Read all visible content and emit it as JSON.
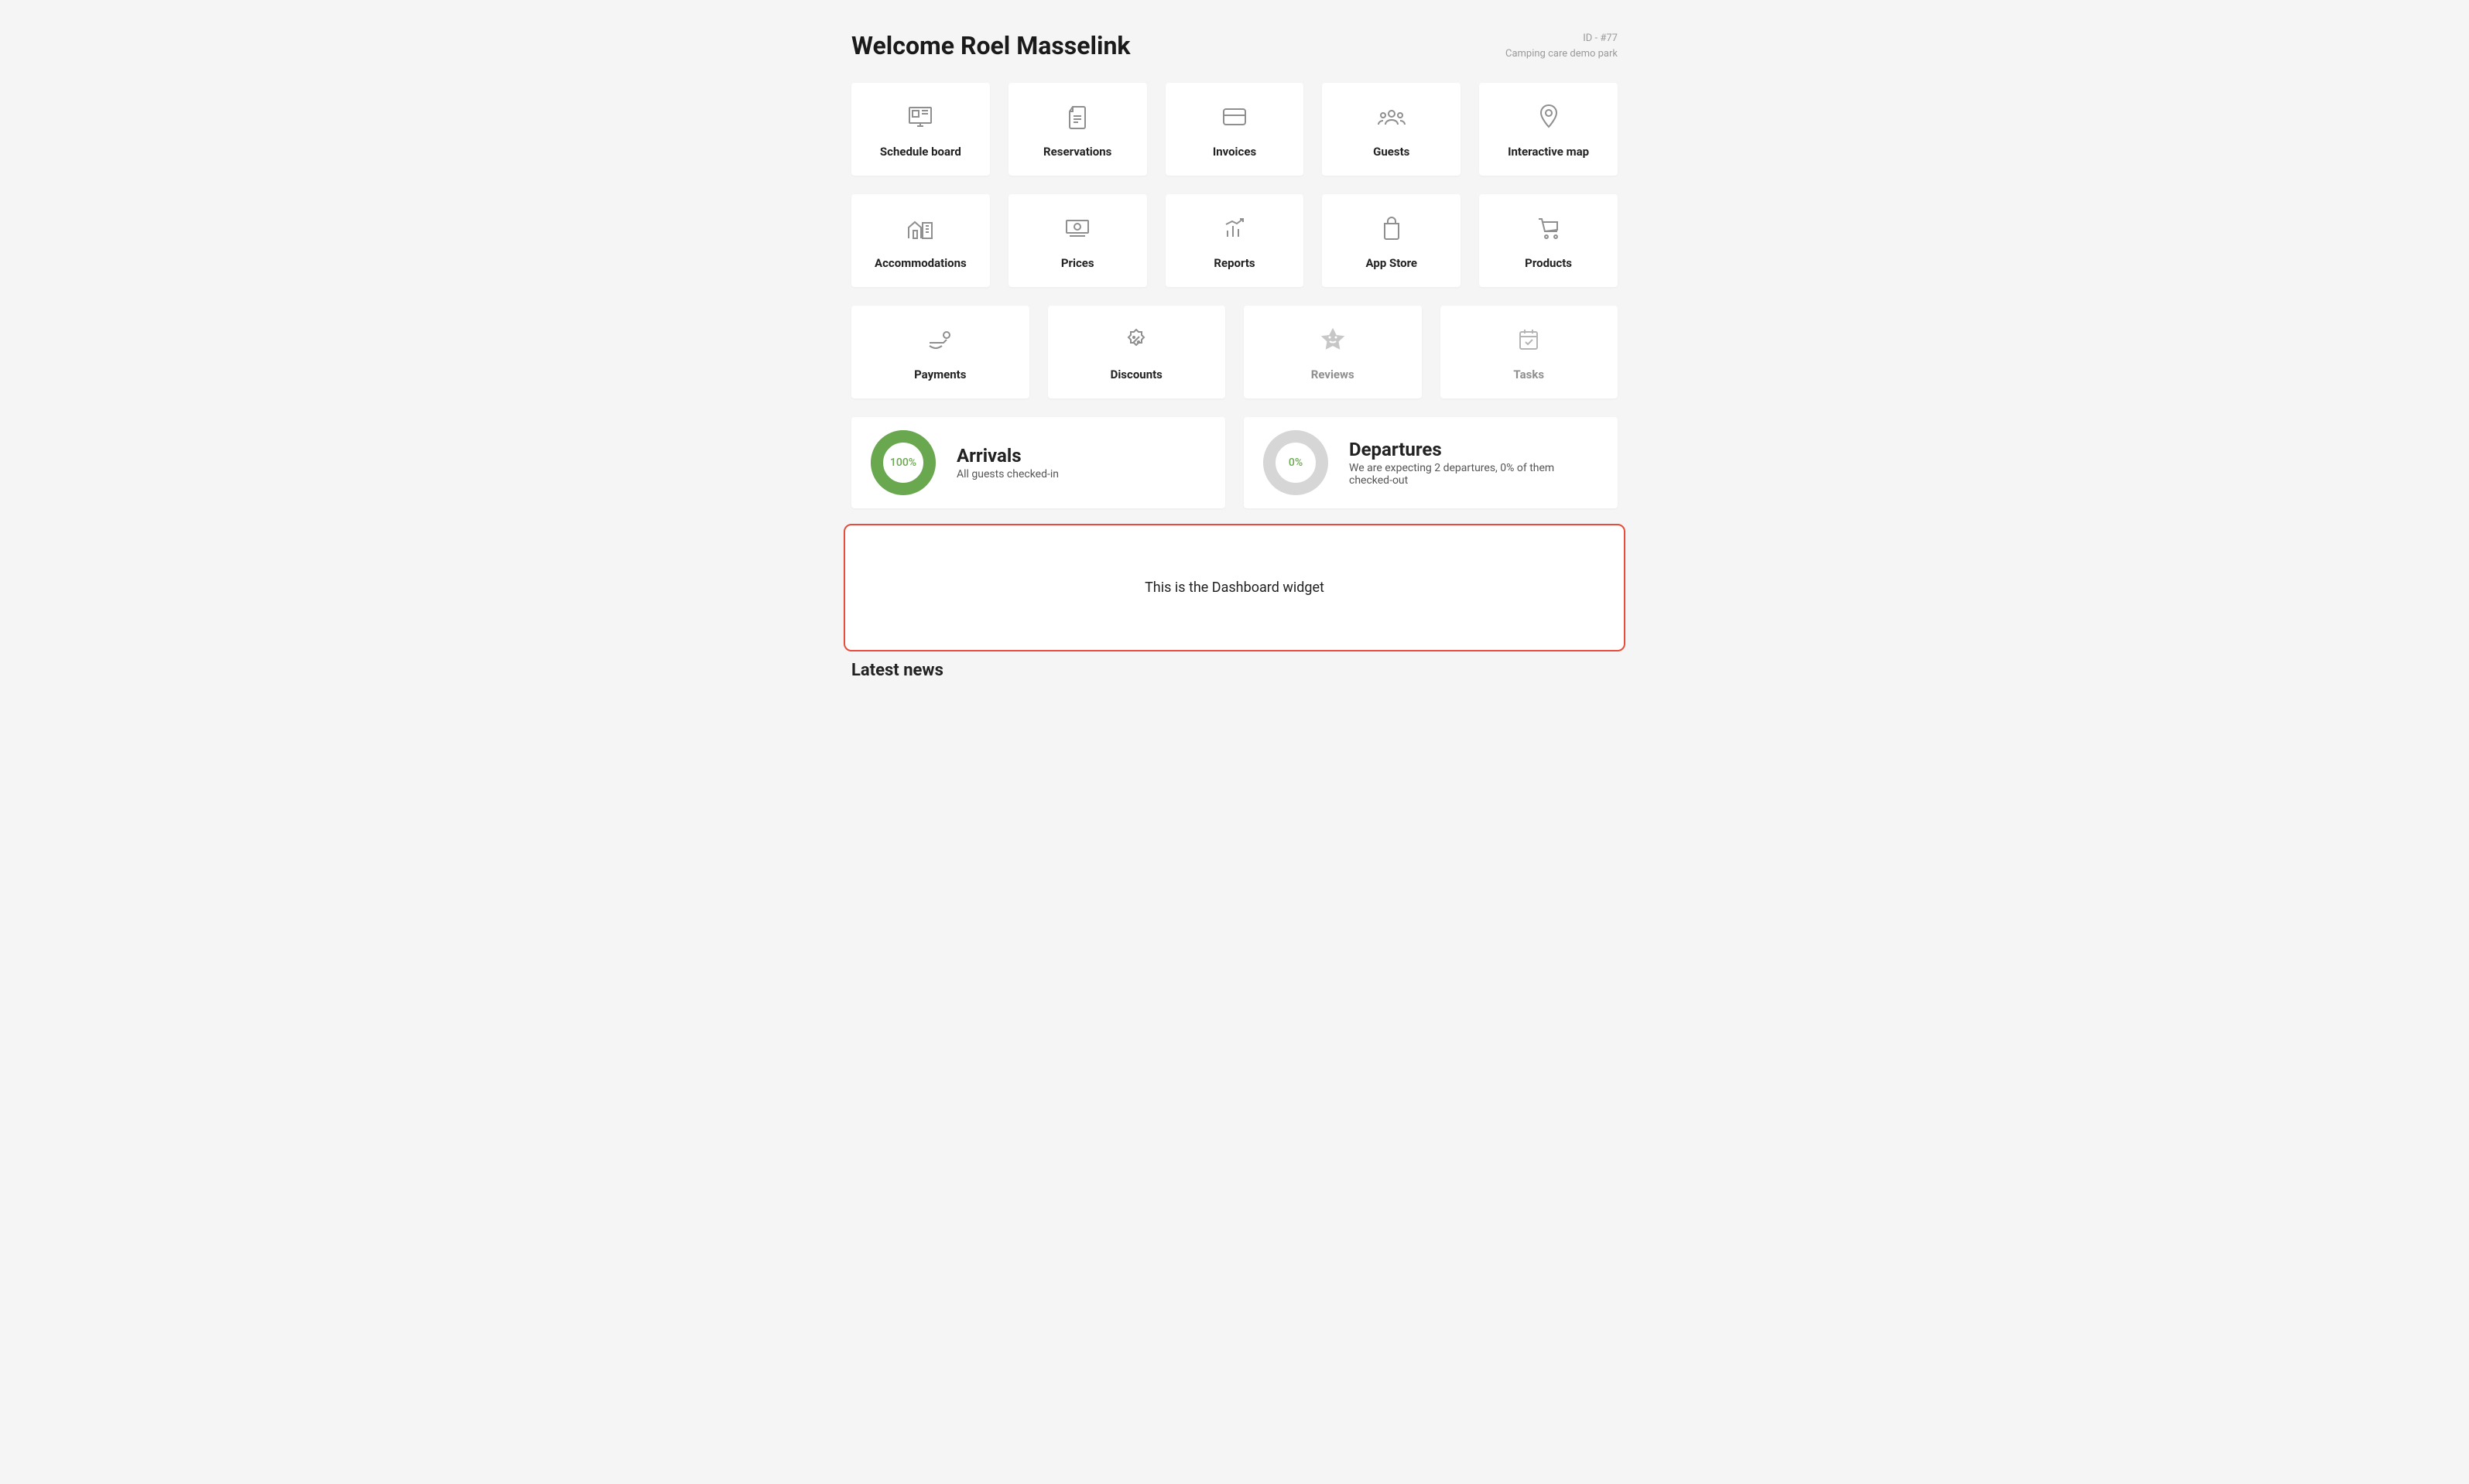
{
  "header": {
    "welcome": "Welcome Roel Masselink",
    "id_label": "ID - #77",
    "park_name": "Camping care demo park"
  },
  "tiles_row1": [
    {
      "label": "Schedule board",
      "icon": "schedule-board-icon",
      "muted": false
    },
    {
      "label": "Reservations",
      "icon": "reservations-icon",
      "muted": false
    },
    {
      "label": "Invoices",
      "icon": "invoices-icon",
      "muted": false
    },
    {
      "label": "Guests",
      "icon": "guests-icon",
      "muted": false
    },
    {
      "label": "Interactive map",
      "icon": "map-pin-icon",
      "muted": false
    }
  ],
  "tiles_row2": [
    {
      "label": "Accommodations",
      "icon": "accommodations-icon",
      "muted": false
    },
    {
      "label": "Prices",
      "icon": "prices-icon",
      "muted": false
    },
    {
      "label": "Reports",
      "icon": "reports-icon",
      "muted": false
    },
    {
      "label": "App Store",
      "icon": "app-store-icon",
      "muted": false
    },
    {
      "label": "Products",
      "icon": "products-icon",
      "muted": false
    }
  ],
  "tiles_row3": [
    {
      "label": "Payments",
      "icon": "payments-icon",
      "muted": false
    },
    {
      "label": "Discounts",
      "icon": "discounts-icon",
      "muted": false
    },
    {
      "label": "Reviews",
      "icon": "reviews-icon",
      "muted": true
    },
    {
      "label": "Tasks",
      "icon": "tasks-icon",
      "muted": true
    }
  ],
  "stats": {
    "arrivals": {
      "percent": 100,
      "percent_label": "100%",
      "title": "Arrivals",
      "subtitle": "All guests checked-in"
    },
    "departures": {
      "percent": 0,
      "percent_label": "0%",
      "title": "Departures",
      "subtitle": "We are expecting 2 departures, 0% of them checked-out"
    }
  },
  "dashboard_widget": {
    "text": "This is the Dashboard widget"
  },
  "latest_news_heading": "Latest news"
}
